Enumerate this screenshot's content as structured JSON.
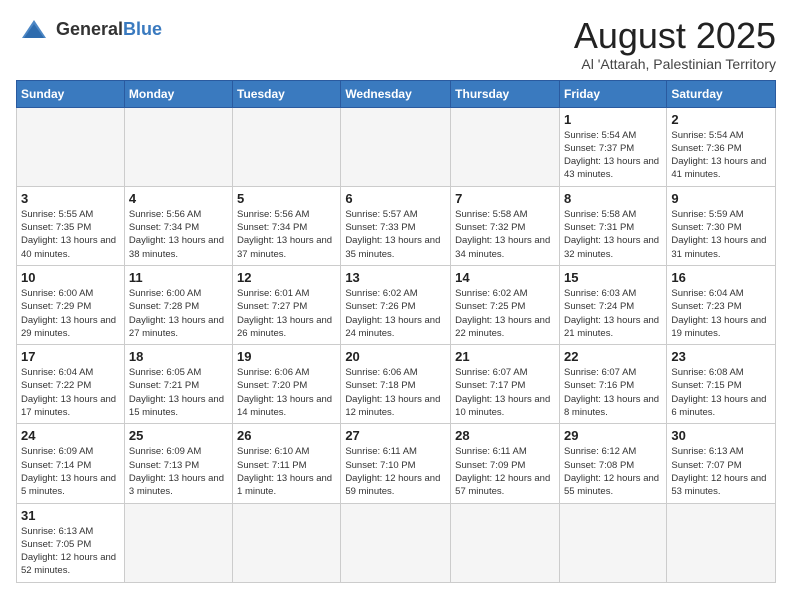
{
  "header": {
    "logo_general": "General",
    "logo_blue": "Blue",
    "title": "August 2025",
    "subtitle": "Al 'Attarah, Palestinian Territory"
  },
  "weekdays": [
    "Sunday",
    "Monday",
    "Tuesday",
    "Wednesday",
    "Thursday",
    "Friday",
    "Saturday"
  ],
  "weeks": [
    [
      {
        "day": "",
        "info": ""
      },
      {
        "day": "",
        "info": ""
      },
      {
        "day": "",
        "info": ""
      },
      {
        "day": "",
        "info": ""
      },
      {
        "day": "",
        "info": ""
      },
      {
        "day": "1",
        "info": "Sunrise: 5:54 AM\nSunset: 7:37 PM\nDaylight: 13 hours\nand 43 minutes."
      },
      {
        "day": "2",
        "info": "Sunrise: 5:54 AM\nSunset: 7:36 PM\nDaylight: 13 hours\nand 41 minutes."
      }
    ],
    [
      {
        "day": "3",
        "info": "Sunrise: 5:55 AM\nSunset: 7:35 PM\nDaylight: 13 hours\nand 40 minutes."
      },
      {
        "day": "4",
        "info": "Sunrise: 5:56 AM\nSunset: 7:34 PM\nDaylight: 13 hours\nand 38 minutes."
      },
      {
        "day": "5",
        "info": "Sunrise: 5:56 AM\nSunset: 7:34 PM\nDaylight: 13 hours\nand 37 minutes."
      },
      {
        "day": "6",
        "info": "Sunrise: 5:57 AM\nSunset: 7:33 PM\nDaylight: 13 hours\nand 35 minutes."
      },
      {
        "day": "7",
        "info": "Sunrise: 5:58 AM\nSunset: 7:32 PM\nDaylight: 13 hours\nand 34 minutes."
      },
      {
        "day": "8",
        "info": "Sunrise: 5:58 AM\nSunset: 7:31 PM\nDaylight: 13 hours\nand 32 minutes."
      },
      {
        "day": "9",
        "info": "Sunrise: 5:59 AM\nSunset: 7:30 PM\nDaylight: 13 hours\nand 31 minutes."
      }
    ],
    [
      {
        "day": "10",
        "info": "Sunrise: 6:00 AM\nSunset: 7:29 PM\nDaylight: 13 hours\nand 29 minutes."
      },
      {
        "day": "11",
        "info": "Sunrise: 6:00 AM\nSunset: 7:28 PM\nDaylight: 13 hours\nand 27 minutes."
      },
      {
        "day": "12",
        "info": "Sunrise: 6:01 AM\nSunset: 7:27 PM\nDaylight: 13 hours\nand 26 minutes."
      },
      {
        "day": "13",
        "info": "Sunrise: 6:02 AM\nSunset: 7:26 PM\nDaylight: 13 hours\nand 24 minutes."
      },
      {
        "day": "14",
        "info": "Sunrise: 6:02 AM\nSunset: 7:25 PM\nDaylight: 13 hours\nand 22 minutes."
      },
      {
        "day": "15",
        "info": "Sunrise: 6:03 AM\nSunset: 7:24 PM\nDaylight: 13 hours\nand 21 minutes."
      },
      {
        "day": "16",
        "info": "Sunrise: 6:04 AM\nSunset: 7:23 PM\nDaylight: 13 hours\nand 19 minutes."
      }
    ],
    [
      {
        "day": "17",
        "info": "Sunrise: 6:04 AM\nSunset: 7:22 PM\nDaylight: 13 hours\nand 17 minutes."
      },
      {
        "day": "18",
        "info": "Sunrise: 6:05 AM\nSunset: 7:21 PM\nDaylight: 13 hours\nand 15 minutes."
      },
      {
        "day": "19",
        "info": "Sunrise: 6:06 AM\nSunset: 7:20 PM\nDaylight: 13 hours\nand 14 minutes."
      },
      {
        "day": "20",
        "info": "Sunrise: 6:06 AM\nSunset: 7:18 PM\nDaylight: 13 hours\nand 12 minutes."
      },
      {
        "day": "21",
        "info": "Sunrise: 6:07 AM\nSunset: 7:17 PM\nDaylight: 13 hours\nand 10 minutes."
      },
      {
        "day": "22",
        "info": "Sunrise: 6:07 AM\nSunset: 7:16 PM\nDaylight: 13 hours\nand 8 minutes."
      },
      {
        "day": "23",
        "info": "Sunrise: 6:08 AM\nSunset: 7:15 PM\nDaylight: 13 hours\nand 6 minutes."
      }
    ],
    [
      {
        "day": "24",
        "info": "Sunrise: 6:09 AM\nSunset: 7:14 PM\nDaylight: 13 hours\nand 5 minutes."
      },
      {
        "day": "25",
        "info": "Sunrise: 6:09 AM\nSunset: 7:13 PM\nDaylight: 13 hours\nand 3 minutes."
      },
      {
        "day": "26",
        "info": "Sunrise: 6:10 AM\nSunset: 7:11 PM\nDaylight: 13 hours\nand 1 minute."
      },
      {
        "day": "27",
        "info": "Sunrise: 6:11 AM\nSunset: 7:10 PM\nDaylight: 12 hours\nand 59 minutes."
      },
      {
        "day": "28",
        "info": "Sunrise: 6:11 AM\nSunset: 7:09 PM\nDaylight: 12 hours\nand 57 minutes."
      },
      {
        "day": "29",
        "info": "Sunrise: 6:12 AM\nSunset: 7:08 PM\nDaylight: 12 hours\nand 55 minutes."
      },
      {
        "day": "30",
        "info": "Sunrise: 6:13 AM\nSunset: 7:07 PM\nDaylight: 12 hours\nand 53 minutes."
      }
    ],
    [
      {
        "day": "31",
        "info": "Sunrise: 6:13 AM\nSunset: 7:05 PM\nDaylight: 12 hours\nand 52 minutes."
      },
      {
        "day": "",
        "info": ""
      },
      {
        "day": "",
        "info": ""
      },
      {
        "day": "",
        "info": ""
      },
      {
        "day": "",
        "info": ""
      },
      {
        "day": "",
        "info": ""
      },
      {
        "day": "",
        "info": ""
      }
    ]
  ]
}
